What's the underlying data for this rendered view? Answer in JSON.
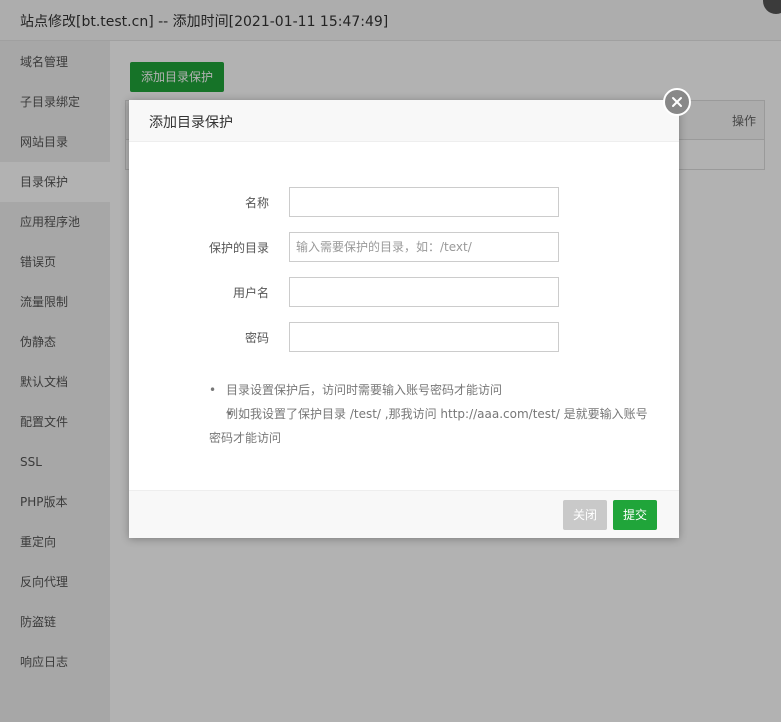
{
  "window": {
    "title": "站点修改[bt.test.cn] -- 添加时间[2021-01-11 15:47:49]"
  },
  "sidebar": {
    "items": [
      {
        "label": "域名管理"
      },
      {
        "label": "子目录绑定"
      },
      {
        "label": "网站目录"
      },
      {
        "label": "目录保护",
        "active": true
      },
      {
        "label": "应用程序池"
      },
      {
        "label": "错误页"
      },
      {
        "label": "流量限制"
      },
      {
        "label": "伪静态"
      },
      {
        "label": "默认文档"
      },
      {
        "label": "配置文件"
      },
      {
        "label": "SSL"
      },
      {
        "label": "PHP版本"
      },
      {
        "label": "重定向"
      },
      {
        "label": "反向代理"
      },
      {
        "label": "防盗链"
      },
      {
        "label": "响应日志"
      }
    ]
  },
  "main": {
    "add_button": "添加目录保护",
    "table": {
      "op_header": "操作"
    }
  },
  "modal": {
    "title": "添加目录保护",
    "fields": {
      "name": {
        "label": "名称",
        "value": "",
        "placeholder": ""
      },
      "dir": {
        "label": "保护的目录",
        "value": "",
        "placeholder": "输入需要保护的目录，如：/text/"
      },
      "user": {
        "label": "用户名",
        "value": "",
        "placeholder": ""
      },
      "password": {
        "label": "密码",
        "value": "",
        "placeholder": ""
      }
    },
    "tips": [
      "目录设置保护后，访问时需要输入账号密码才能访问",
      "例如我设置了保护目录 /test/ ,那我访问 http://aaa.com/test/ 是就要输入账号密码才能访问"
    ],
    "close_button": "关闭",
    "submit_button": "提交"
  },
  "colors": {
    "accent": "#20a53a",
    "disabled": "#c9c9c9"
  }
}
